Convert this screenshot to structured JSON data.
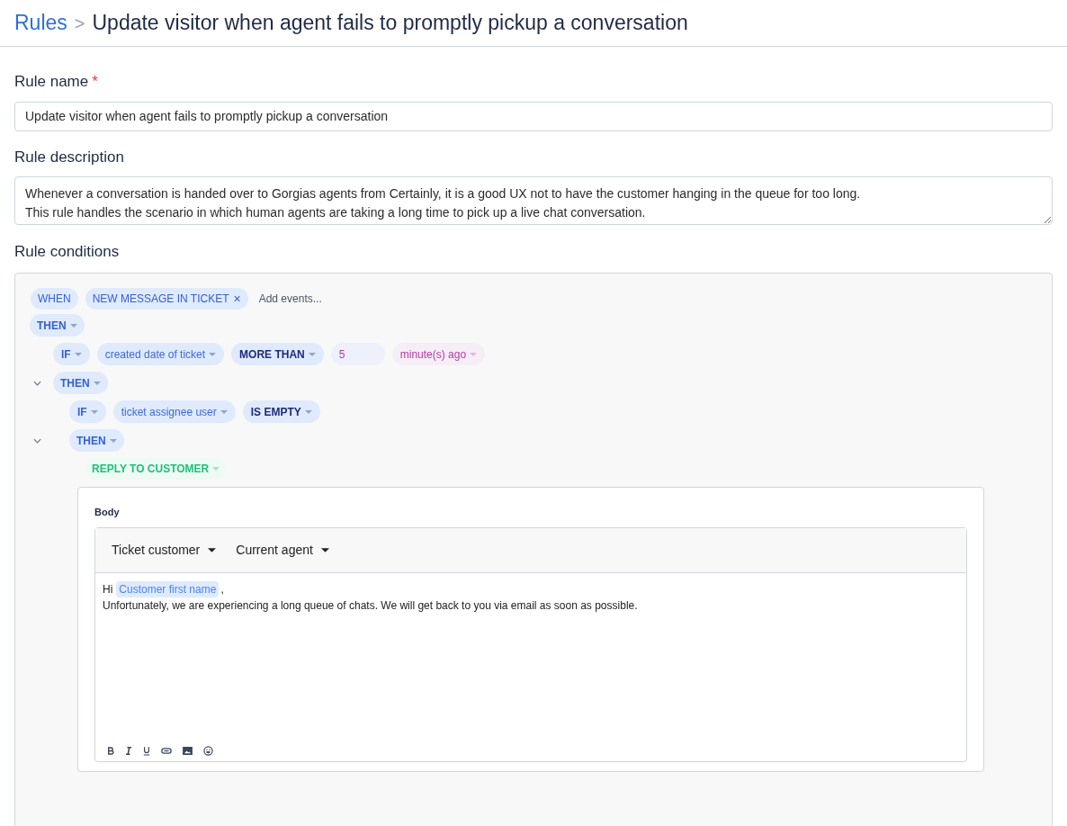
{
  "breadcrumb": {
    "parent": "Rules",
    "separator": ">",
    "current": "Update visitor when agent fails to promptly pickup a conversation"
  },
  "rule_name": {
    "label": "Rule name",
    "required_mark": "*",
    "value": "Update visitor when agent fails to promptly pickup a conversation"
  },
  "rule_description": {
    "label": "Rule description",
    "value": "Whenever a conversation is handed over to Gorgias agents from Certainly, it is a good UX not to have the customer hanging in the queue for too long.\nThis rule handles the scenario in which human agents are taking a long time to pick up a live chat conversation."
  },
  "rule_conditions": {
    "label": "Rule conditions",
    "when": {
      "label": "WHEN",
      "events": [
        {
          "label": "NEW MESSAGE IN TICKET",
          "remove": "×"
        }
      ],
      "add_placeholder": "Add events..."
    },
    "tree": {
      "kind": "then",
      "label": "THEN",
      "children": [
        {
          "kind": "if",
          "parts": [
            {
              "kind": "operator",
              "label": "IF"
            },
            {
              "kind": "field",
              "label": "created date of ticket"
            },
            {
              "kind": "comparator",
              "label": "MORE THAN"
            },
            {
              "kind": "value",
              "label": "5"
            },
            {
              "kind": "unit",
              "label": "minute(s) ago"
            }
          ]
        },
        {
          "kind": "then",
          "label": "THEN",
          "expanded": true,
          "children": [
            {
              "kind": "if",
              "parts": [
                {
                  "kind": "operator",
                  "label": "IF"
                },
                {
                  "kind": "field",
                  "label": "ticket assignee user"
                },
                {
                  "kind": "comparator",
                  "label": "IS EMPTY"
                }
              ]
            },
            {
              "kind": "then",
              "label": "THEN",
              "expanded": true,
              "children": [
                {
                  "kind": "action",
                  "label": "REPLY TO CUSTOMER",
                  "body": {
                    "label": "Body",
                    "toolbar": [
                      "Ticket customer",
                      "Current agent"
                    ],
                    "greeting": "Hi",
                    "variable": "Customer first name",
                    "after_variable": ",",
                    "text": "Unfortunately, we are experiencing a long queue of chats. We will get back to you via email as soon as possible."
                  }
                }
              ]
            }
          ]
        }
      ]
    }
  }
}
